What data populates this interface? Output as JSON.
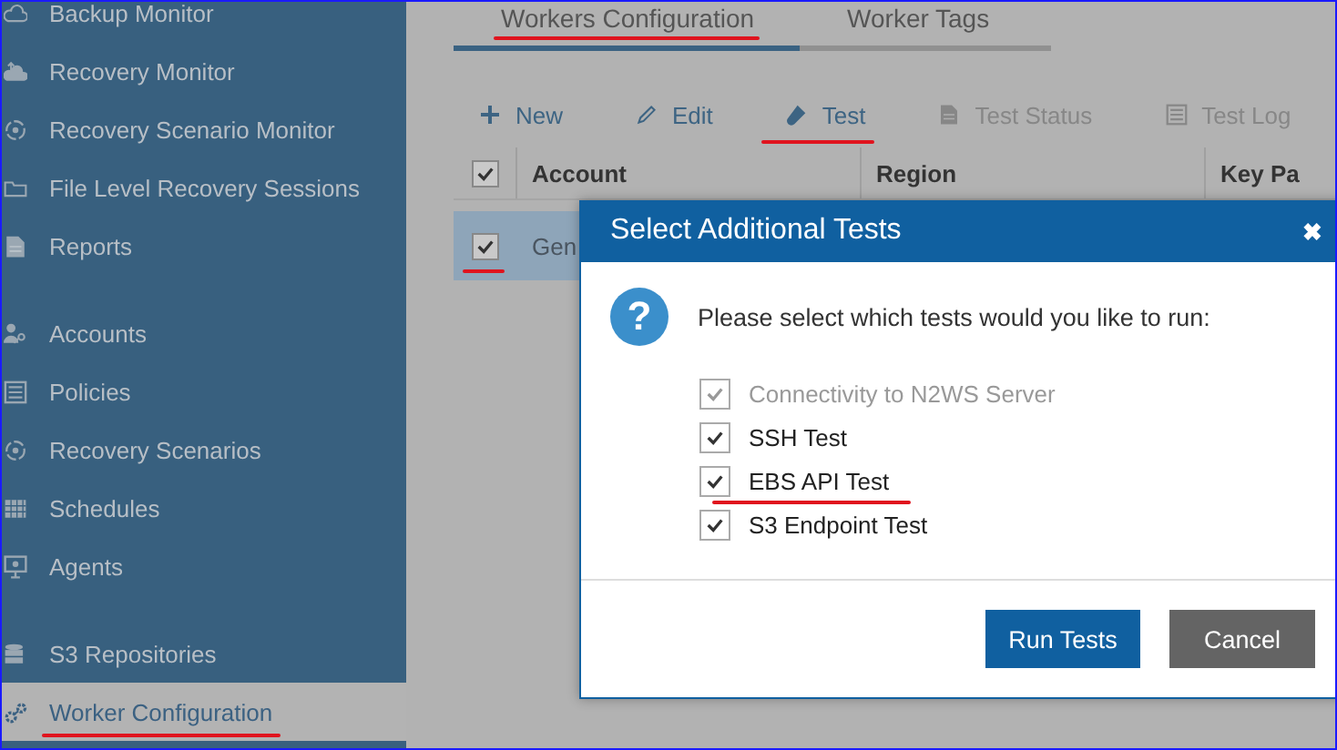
{
  "sidebar": {
    "groups": [
      [
        {
          "label": "Backup Monitor",
          "kind": "cloud",
          "selected": false,
          "underlined": false
        },
        {
          "label": "Recovery Monitor",
          "kind": "cloud-up",
          "selected": false,
          "underlined": false
        },
        {
          "label": "Recovery Scenario Monitor",
          "kind": "cycle",
          "selected": false,
          "underlined": false
        },
        {
          "label": "File Level Recovery Sessions",
          "kind": "folder",
          "selected": false,
          "underlined": false
        },
        {
          "label": "Reports",
          "kind": "document",
          "selected": false,
          "underlined": false
        }
      ],
      [
        {
          "label": "Accounts",
          "kind": "user-key",
          "selected": false,
          "underlined": false
        },
        {
          "label": "Policies",
          "kind": "list",
          "selected": false,
          "underlined": false
        },
        {
          "label": "Recovery Scenarios",
          "kind": "cycle",
          "selected": false,
          "underlined": false
        },
        {
          "label": "Schedules",
          "kind": "calendar",
          "selected": false,
          "underlined": false
        },
        {
          "label": "Agents",
          "kind": "monitor",
          "selected": false,
          "underlined": false
        }
      ],
      [
        {
          "label": "S3 Repositories",
          "kind": "database",
          "selected": false,
          "underlined": false
        },
        {
          "label": "Worker Configuration",
          "kind": "gears",
          "selected": true,
          "underlined": true
        }
      ]
    ]
  },
  "tabs": [
    {
      "label": "Workers Configuration",
      "selected": true,
      "underlined": true
    },
    {
      "label": "Worker Tags",
      "selected": false,
      "underlined": false
    }
  ],
  "toolbar": [
    {
      "label": "New",
      "kind": "plus",
      "disabled": false,
      "underlined": false
    },
    {
      "label": "Edit",
      "kind": "pencil",
      "disabled": false,
      "underlined": false
    },
    {
      "label": "Test",
      "kind": "tube",
      "disabled": false,
      "underlined": true
    },
    {
      "label": "Test Status",
      "kind": "document",
      "disabled": true,
      "underlined": false
    },
    {
      "label": "Test Log",
      "kind": "list",
      "disabled": true,
      "underlined": false
    }
  ],
  "table": {
    "header_checked": true,
    "columns": [
      "Account",
      "Region",
      "Key Pa"
    ],
    "rows": [
      {
        "cells": [
          "Gen"
        ],
        "checked": true,
        "selected": true,
        "underlined": true
      }
    ]
  },
  "dialog": {
    "title": "Select Additional Tests",
    "close": "✖",
    "question_mark": "?",
    "prompt": "Please select which tests would you like to run:",
    "options": [
      {
        "label": "Connectivity to N2WS Server",
        "checked": true,
        "disabled": true,
        "underlined": false
      },
      {
        "label": "SSH Test",
        "checked": true,
        "disabled": false,
        "underlined": false
      },
      {
        "label": "EBS API Test",
        "checked": true,
        "disabled": false,
        "underlined": true
      },
      {
        "label": "S3 Endpoint Test",
        "checked": true,
        "disabled": false,
        "underlined": false
      }
    ],
    "buttons": [
      {
        "label": "Run Tests",
        "kind": "primary"
      },
      {
        "label": "Cancel",
        "kind": "secondary"
      }
    ]
  }
}
